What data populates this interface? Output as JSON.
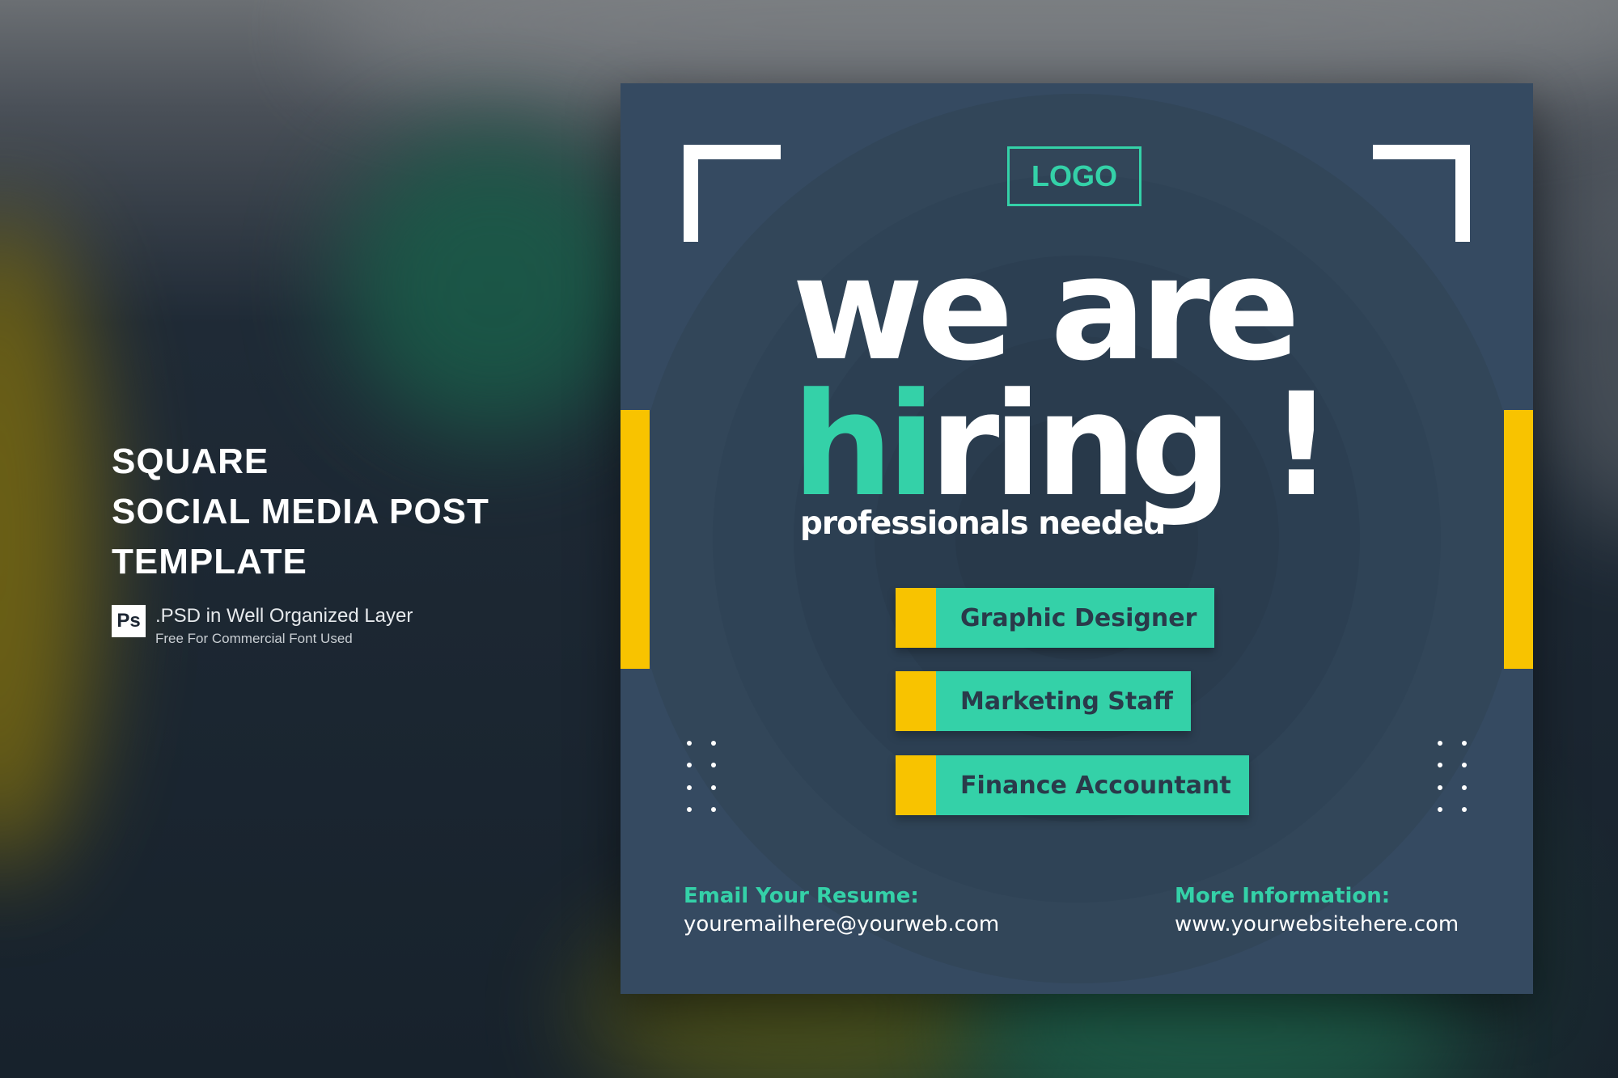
{
  "side": {
    "title_lines": [
      "SQUARE",
      "SOCIAL MEDIA POST",
      "TEMPLATE"
    ],
    "ps_icon": "Ps",
    "ps_line1": ".PSD in Well Organized Layer",
    "ps_line2": "Free For Commercial Font Used"
  },
  "post": {
    "logo": "LOGO",
    "headline_line1": "we are",
    "headline_accent": "hi",
    "headline_rest": "ring !",
    "subheadline": "professionals needed",
    "jobs": [
      "Graphic Designer",
      "Marketing Staff",
      "Finance Accountant"
    ],
    "email_heading": "Email Your Resume:",
    "email_value": "youremailhere@yourweb.com",
    "info_heading": "More Information:",
    "info_value": "www.yourwebsitehere.com"
  },
  "colors": {
    "accent": "#34d1a8",
    "highlight": "#f8c300",
    "card_bg": "#354a61"
  }
}
